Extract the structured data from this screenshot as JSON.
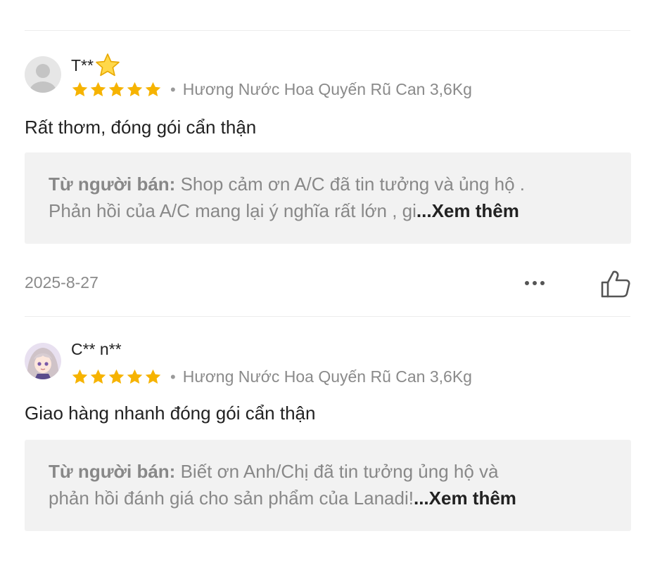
{
  "reviews": [
    {
      "username": "T**",
      "username_emoji": "star-emoji-icon",
      "rating": 5,
      "variant": "Hương Nước Hoa Quyến Rũ Can 3,6Kg",
      "comment": "Rất thơm, đóng gói cẩn thận",
      "seller_reply": {
        "label": "Từ người bán:",
        "line1": "Shop cảm ơn A/C đã tin tưởng và ủng hộ .",
        "line2": "Phản hồi của A/C mang lại ý nghĩa rất lớn , gi",
        "more": "...Xem thêm"
      },
      "date": "2025-8-27"
    },
    {
      "username": "C** n**",
      "rating": 5,
      "variant": "Hương Nước Hoa Quyến Rũ Can 3,6Kg",
      "comment": "Giao hàng nhanh đóng gói cẩn thận",
      "seller_reply": {
        "label": "Từ người bán:",
        "line1": "Biết ơn Anh/Chị đã tin tưởng ủng hộ và",
        "line2": "phản hồi đánh giá cho sản phẩm của Lanadi!",
        "more": "...Xem thêm"
      }
    }
  ],
  "colors": {
    "star": "#f6b300",
    "seller_box_bg": "#f2f2f2",
    "muted_text": "#8a8a8a"
  }
}
